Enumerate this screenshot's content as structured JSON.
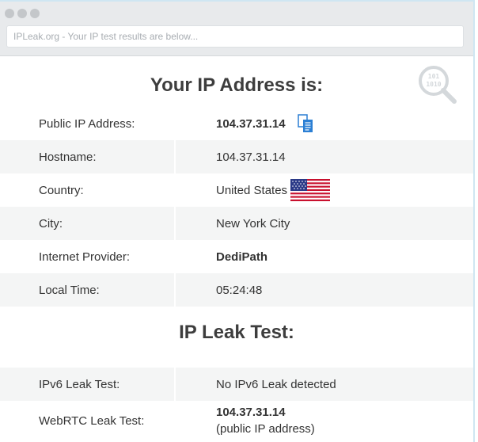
{
  "browser": {
    "address_placeholder": "IPLeak.org - Your IP test results are below..."
  },
  "section1": {
    "title": "Your IP Address is:",
    "rows": [
      {
        "label": "Public IP Address:",
        "value": "104.37.31.14"
      },
      {
        "label": "Hostname:",
        "value": "104.37.31.14"
      },
      {
        "label": "Country:",
        "value": "United States"
      },
      {
        "label": "City:",
        "value": "New York City"
      },
      {
        "label": "Internet Provider:",
        "value": "DediPath"
      },
      {
        "label": "Local Time:",
        "value": "05:24:48"
      }
    ]
  },
  "section2": {
    "title": "IP Leak Test:",
    "rows": [
      {
        "label": "IPv6 Leak Test:",
        "value": "No IPv6 Leak detected"
      },
      {
        "label": "WebRTC Leak Test:",
        "value": "104.37.31.14",
        "note": "(public IP address)"
      }
    ]
  },
  "icons": {
    "copy": "copy-icon",
    "flag": "us-flag-icon",
    "search": "magnifier-icon"
  },
  "colors": {
    "shade_row": "#f4f5f5",
    "copy_icon": "#2b7fd4",
    "chrome": "#e8eaec"
  }
}
